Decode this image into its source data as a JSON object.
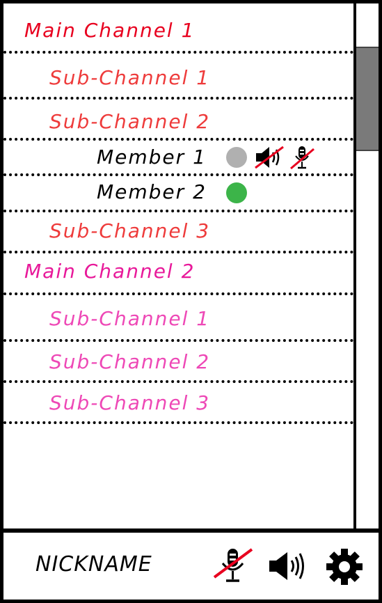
{
  "channels": {
    "main1": {
      "label": "Main Channel 1",
      "color": "#e8001f"
    },
    "main1_sub1": {
      "label": "Sub-Channel 1"
    },
    "main1_sub2": {
      "label": "Sub-Channel 2"
    },
    "member1": {
      "label": "Member 1",
      "status_color": "#b0b0b0",
      "speaker_muted": true,
      "mic_muted": true
    },
    "member2": {
      "label": "Member 2",
      "status_color": "#3cb449"
    },
    "main1_sub3": {
      "label": "Sub-Channel 3"
    },
    "main2": {
      "label": "Main Channel 2",
      "color": "#e8199a"
    },
    "main2_sub1": {
      "label": "Sub-Channel 1"
    },
    "main2_sub2": {
      "label": "Sub-Channel 2"
    },
    "main2_sub3": {
      "label": "Sub-Channel 3"
    }
  },
  "footer": {
    "nickname": "NICKNAME",
    "mic_muted": true,
    "icons": [
      "microphone-muted-icon",
      "speaker-icon",
      "gear-icon"
    ]
  }
}
